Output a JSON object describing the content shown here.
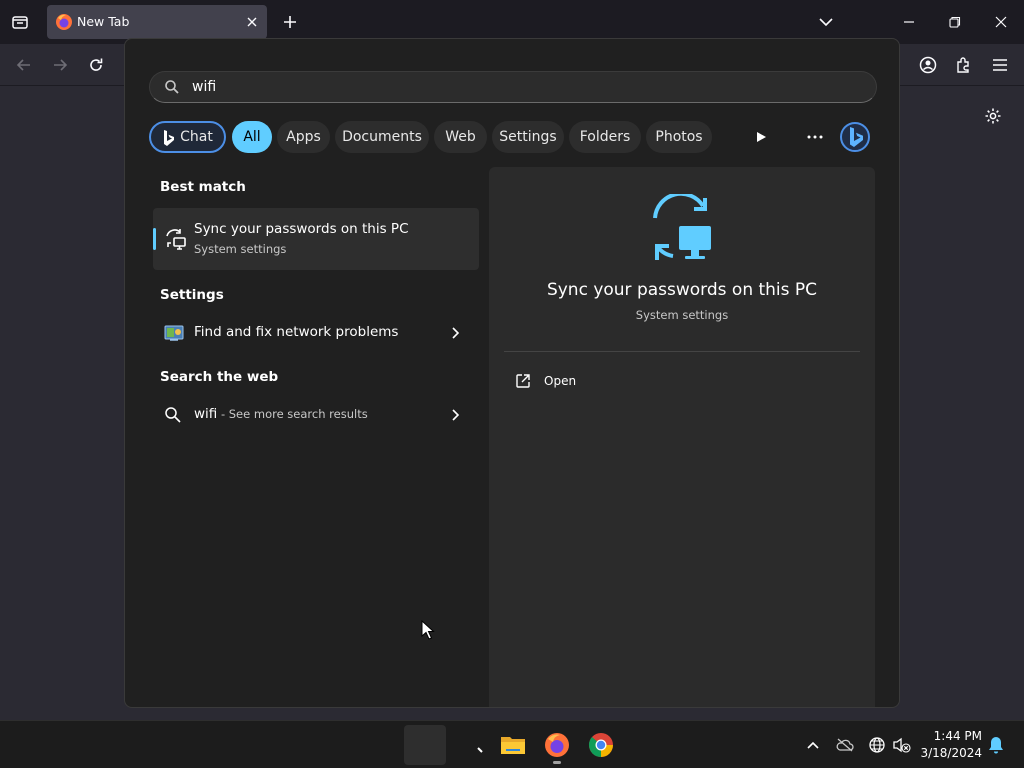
{
  "browser": {
    "tab": {
      "title": "New Tab"
    },
    "colors": {
      "accent": "#60cdff",
      "firefox_orange": "#ff7139"
    }
  },
  "search": {
    "query": "wifi",
    "filters": [
      {
        "label": "Chat",
        "state": "copilot"
      },
      {
        "label": "All",
        "state": "active"
      },
      {
        "label": "Apps"
      },
      {
        "label": "Documents"
      },
      {
        "label": "Web"
      },
      {
        "label": "Settings"
      },
      {
        "label": "Folders"
      },
      {
        "label": "Photos"
      }
    ],
    "sections": {
      "best_match": "Best match",
      "settings": "Settings",
      "web": "Search the web"
    },
    "best_match": {
      "title": "Sync your passwords on this PC",
      "subtitle": "System settings",
      "icon": "sync-device-icon"
    },
    "settings_results": [
      {
        "label": "Find and fix network problems",
        "icon": "network-troubleshoot-icon"
      }
    ],
    "web_results": [
      {
        "query": "wifi",
        "suffix": " - See more search results",
        "icon": "search-icon"
      }
    ],
    "preview": {
      "title": "Sync your passwords on this PC",
      "subtitle": "System settings",
      "actions": [
        {
          "label": "Open",
          "icon": "open-external-icon"
        }
      ]
    }
  },
  "taskbar": {
    "apps": [
      "start",
      "search",
      "file-explorer",
      "firefox",
      "chrome"
    ],
    "clock": {
      "time": "1:44 PM",
      "date": "3/18/2024"
    }
  }
}
